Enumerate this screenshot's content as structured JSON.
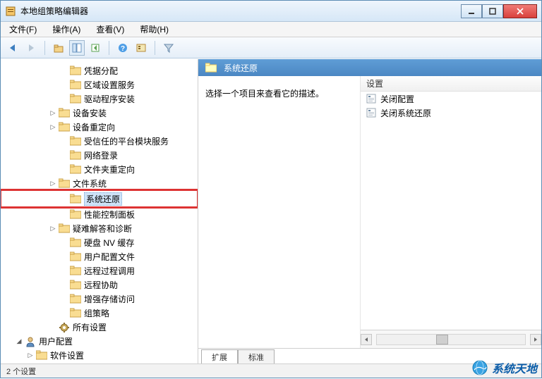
{
  "title": "本地组策略编辑器",
  "menus": {
    "file": "文件(F)",
    "action": "操作(A)",
    "view": "查看(V)",
    "help": "帮助(H)"
  },
  "toolbar_icons": {
    "back": "back-arrow",
    "forward": "forward-arrow",
    "up": "up-level",
    "tree": "show-tree",
    "refresh": "refresh",
    "help": "help",
    "props": "properties",
    "filter": "filter"
  },
  "tree": {
    "items": [
      {
        "label": "凭据分配",
        "indent": 4,
        "toggle": "",
        "icon": "folder"
      },
      {
        "label": "区域设置服务",
        "indent": 4,
        "toggle": "",
        "icon": "folder"
      },
      {
        "label": "驱动程序安装",
        "indent": 4,
        "toggle": "",
        "icon": "folder"
      },
      {
        "label": "设备安装",
        "indent": 3,
        "toggle": "▷",
        "icon": "folder"
      },
      {
        "label": "设备重定向",
        "indent": 3,
        "toggle": "▷",
        "icon": "folder"
      },
      {
        "label": "受信任的平台模块服务",
        "indent": 4,
        "toggle": "",
        "icon": "folder"
      },
      {
        "label": "网络登录",
        "indent": 4,
        "toggle": "",
        "icon": "folder"
      },
      {
        "label": "文件夹重定向",
        "indent": 4,
        "toggle": "",
        "icon": "folder"
      },
      {
        "label": "文件系统",
        "indent": 3,
        "toggle": "▷",
        "icon": "folder"
      },
      {
        "label": "系统还原",
        "indent": 4,
        "toggle": "",
        "icon": "folder",
        "selected": true,
        "highlighted": true
      },
      {
        "label": "性能控制面板",
        "indent": 4,
        "toggle": "",
        "icon": "folder"
      },
      {
        "label": "疑难解答和诊断",
        "indent": 3,
        "toggle": "▷",
        "icon": "folder"
      },
      {
        "label": "硬盘 NV 缓存",
        "indent": 4,
        "toggle": "",
        "icon": "folder"
      },
      {
        "label": "用户配置文件",
        "indent": 4,
        "toggle": "",
        "icon": "folder"
      },
      {
        "label": "远程过程调用",
        "indent": 4,
        "toggle": "",
        "icon": "folder"
      },
      {
        "label": "远程协助",
        "indent": 4,
        "toggle": "",
        "icon": "folder"
      },
      {
        "label": "增强存储访问",
        "indent": 4,
        "toggle": "",
        "icon": "folder"
      },
      {
        "label": "组策略",
        "indent": 4,
        "toggle": "",
        "icon": "folder"
      },
      {
        "label": "所有设置",
        "indent": 3,
        "toggle": "",
        "icon": "gear"
      },
      {
        "label": "用户配置",
        "indent": 0,
        "toggle": "◢",
        "icon": "user"
      },
      {
        "label": "软件设置",
        "indent": 1,
        "toggle": "▷",
        "icon": "folder"
      }
    ]
  },
  "details": {
    "header": "系统还原",
    "description": "选择一个项目来查看它的描述。",
    "column_label": "设置",
    "settings": [
      {
        "label": "关闭配置"
      },
      {
        "label": "关闭系统还原"
      }
    ],
    "tabs": {
      "extended": "扩展",
      "standard": "标准"
    }
  },
  "status": "2 个设置",
  "watermark": "系统天地"
}
